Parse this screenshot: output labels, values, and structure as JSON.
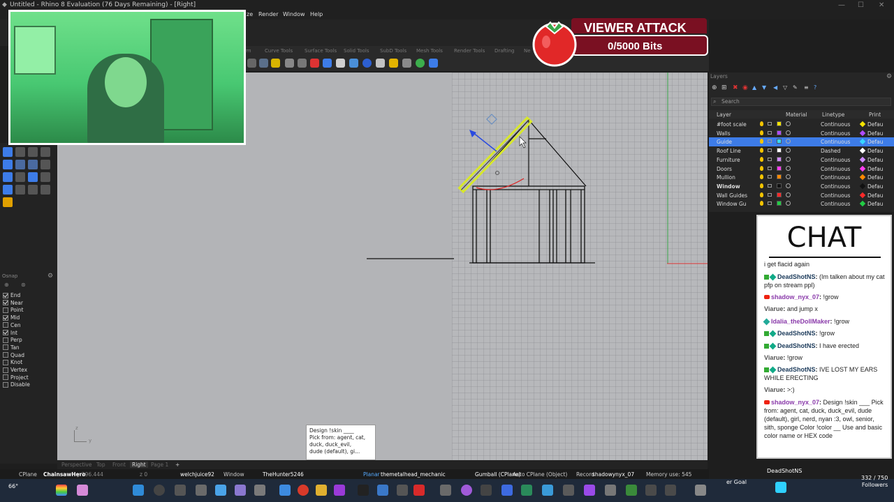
{
  "window": {
    "title": "Untitled - Rhino 8 Evaluation (76 Days Remaining) - [Right]",
    "controls": [
      "—",
      "☐",
      "✕"
    ]
  },
  "menu": [
    "ze",
    "Render",
    "Window",
    "Help"
  ],
  "toolbar_tabs": [
    "rm",
    "Curve Tools",
    "Surface Tools",
    "Solid Tools",
    "SubD Tools",
    "Mesh Tools",
    "Render Tools",
    "Drafting",
    "Ne"
  ],
  "osnap": {
    "header": "Osnap",
    "items": [
      {
        "label": "End",
        "checked": true
      },
      {
        "label": "Near",
        "checked": true
      },
      {
        "label": "Point",
        "checked": false
      },
      {
        "label": "Mid",
        "checked": true
      },
      {
        "label": "Cen",
        "checked": false
      },
      {
        "label": "Int",
        "checked": true
      },
      {
        "label": "Perp",
        "checked": false
      },
      {
        "label": "Tan",
        "checked": false
      },
      {
        "label": "Quad",
        "checked": false
      },
      {
        "label": "Knot",
        "checked": false
      },
      {
        "label": "Vertex",
        "checked": false
      },
      {
        "label": "Project",
        "checked": false
      },
      {
        "label": "Disable",
        "checked": false
      }
    ]
  },
  "viewport": {
    "tooltip": [
      "Design !skin ____",
      "Pick from: agent, cat,",
      "duck, duck_evil,",
      "dude (default), gi..."
    ],
    "axis_z": "z",
    "axis_y": "y"
  },
  "viewport_tabs": {
    "items": [
      "Perspective",
      "Top",
      "Front",
      "Right",
      "Page 1"
    ],
    "active": "Right",
    "add": "+"
  },
  "status": {
    "cplane": "CPlane",
    "coords": "y 296.444",
    "z": "z 0",
    "overlay_users": [
      "ChainsawHero",
      "welchjuice92",
      "TheHunter5246",
      "Idalia_theDollMaker",
      "themetalhead_mechanic",
      "shadowynyx_07"
    ],
    "window": "Window",
    "planar": "Planar",
    "gumball": "Gumball (CPlane)",
    "auto_cplane": "Auto CPlane (Object)",
    "record": "Record",
    "memory": "Memory use: 545"
  },
  "layers": {
    "title": "Layers",
    "search_placeholder": "Search",
    "columns": {
      "layer": "Layer",
      "material": "Material",
      "linetype": "Linetype",
      "print": "Print"
    },
    "rows": [
      {
        "name": "#foot scale",
        "color": "#f5e400",
        "linetype": "Continuous",
        "print": "Defau",
        "pcolor": "#f5e400",
        "selected": false,
        "bold": false
      },
      {
        "name": "Walls",
        "color": "#b04cff",
        "linetype": "Continuous",
        "print": "Defau",
        "pcolor": "#b04cff",
        "selected": false,
        "bold": false
      },
      {
        "name": "Guide",
        "color": "#37d7ff",
        "linetype": "Continuous",
        "print": "Defau",
        "pcolor": "#37d7ff",
        "selected": true,
        "bold": false
      },
      {
        "name": "Roof Line",
        "color": "#ffffff",
        "linetype": "Dashed",
        "print": "Defau",
        "pcolor": "#ffffff",
        "selected": false,
        "bold": false
      },
      {
        "name": "Furniture",
        "color": "#d08cff",
        "linetype": "Continuous",
        "print": "Defau",
        "pcolor": "#d08cff",
        "selected": false,
        "bold": false
      },
      {
        "name": "Doors",
        "color": "#ff3df0",
        "linetype": "Continuous",
        "print": "Defau",
        "pcolor": "#ff3df0",
        "selected": false,
        "bold": false
      },
      {
        "name": "Mullion",
        "color": "#ff8a00",
        "linetype": "Continuous",
        "print": "Defau",
        "pcolor": "#ff8a00",
        "selected": false,
        "bold": false
      },
      {
        "name": "Window",
        "color": "#111111",
        "linetype": "Continuous",
        "print": "Defau",
        "pcolor": "#111111",
        "selected": false,
        "bold": true
      },
      {
        "name": "Wall Guides",
        "color": "#ff2a2a",
        "linetype": "Continuous",
        "print": "Defau",
        "pcolor": "#ff2a2a",
        "selected": false,
        "bold": false
      },
      {
        "name": "Window Gu",
        "color": "#22cc44",
        "linetype": "Continuous",
        "print": "Defau",
        "pcolor": "#22cc44",
        "selected": false,
        "bold": false
      }
    ]
  },
  "chat": {
    "title": "CHAT",
    "messages": [
      {
        "user": "",
        "text": "i get flacid again",
        "badge": ""
      },
      {
        "user": "DeadShotNS",
        "text": "(Im talken about my cat pfp on stream ppl)",
        "badge": "g"
      },
      {
        "user": "shadow_nyx_07",
        "text": "!grow",
        "badge": "yt"
      },
      {
        "user": "Viarue",
        "text": "and jump x",
        "badge": ""
      },
      {
        "user": "Idalia_theDollMaker",
        "text": "!grow",
        "badge": "gl"
      },
      {
        "user": "DeadShotNS",
        "text": "!grow",
        "badge": "g"
      },
      {
        "user": "DeadShotNS",
        "text": "I have erected",
        "badge": "g"
      },
      {
        "user": "Viarue",
        "text": "!grow",
        "badge": ""
      },
      {
        "user": "DeadShotNS",
        "text": "IVE LOST MY EARS WHILE ERECTING",
        "badge": "g"
      },
      {
        "user": "Viarue",
        "text": ">:)",
        "badge": ""
      },
      {
        "user": "shadow_nyx_07",
        "text": "Design !skin ___ Pick from: agent, cat, duck, duck_evil, dude (default), girl, nerd, nyan :3, owl, senior, sith, sponge Color !color __ Use and basic color name or HEX code",
        "badge": "yt"
      }
    ]
  },
  "overlay": {
    "attack_title": "VIEWER ATTACK",
    "attack_bits": "0/5000 Bits",
    "goal_label": "er Goal",
    "goal_user": "DeadShotNS",
    "followers_count": "332 / 750",
    "followers_label": "Followers"
  },
  "taskbar_temp": "66°"
}
